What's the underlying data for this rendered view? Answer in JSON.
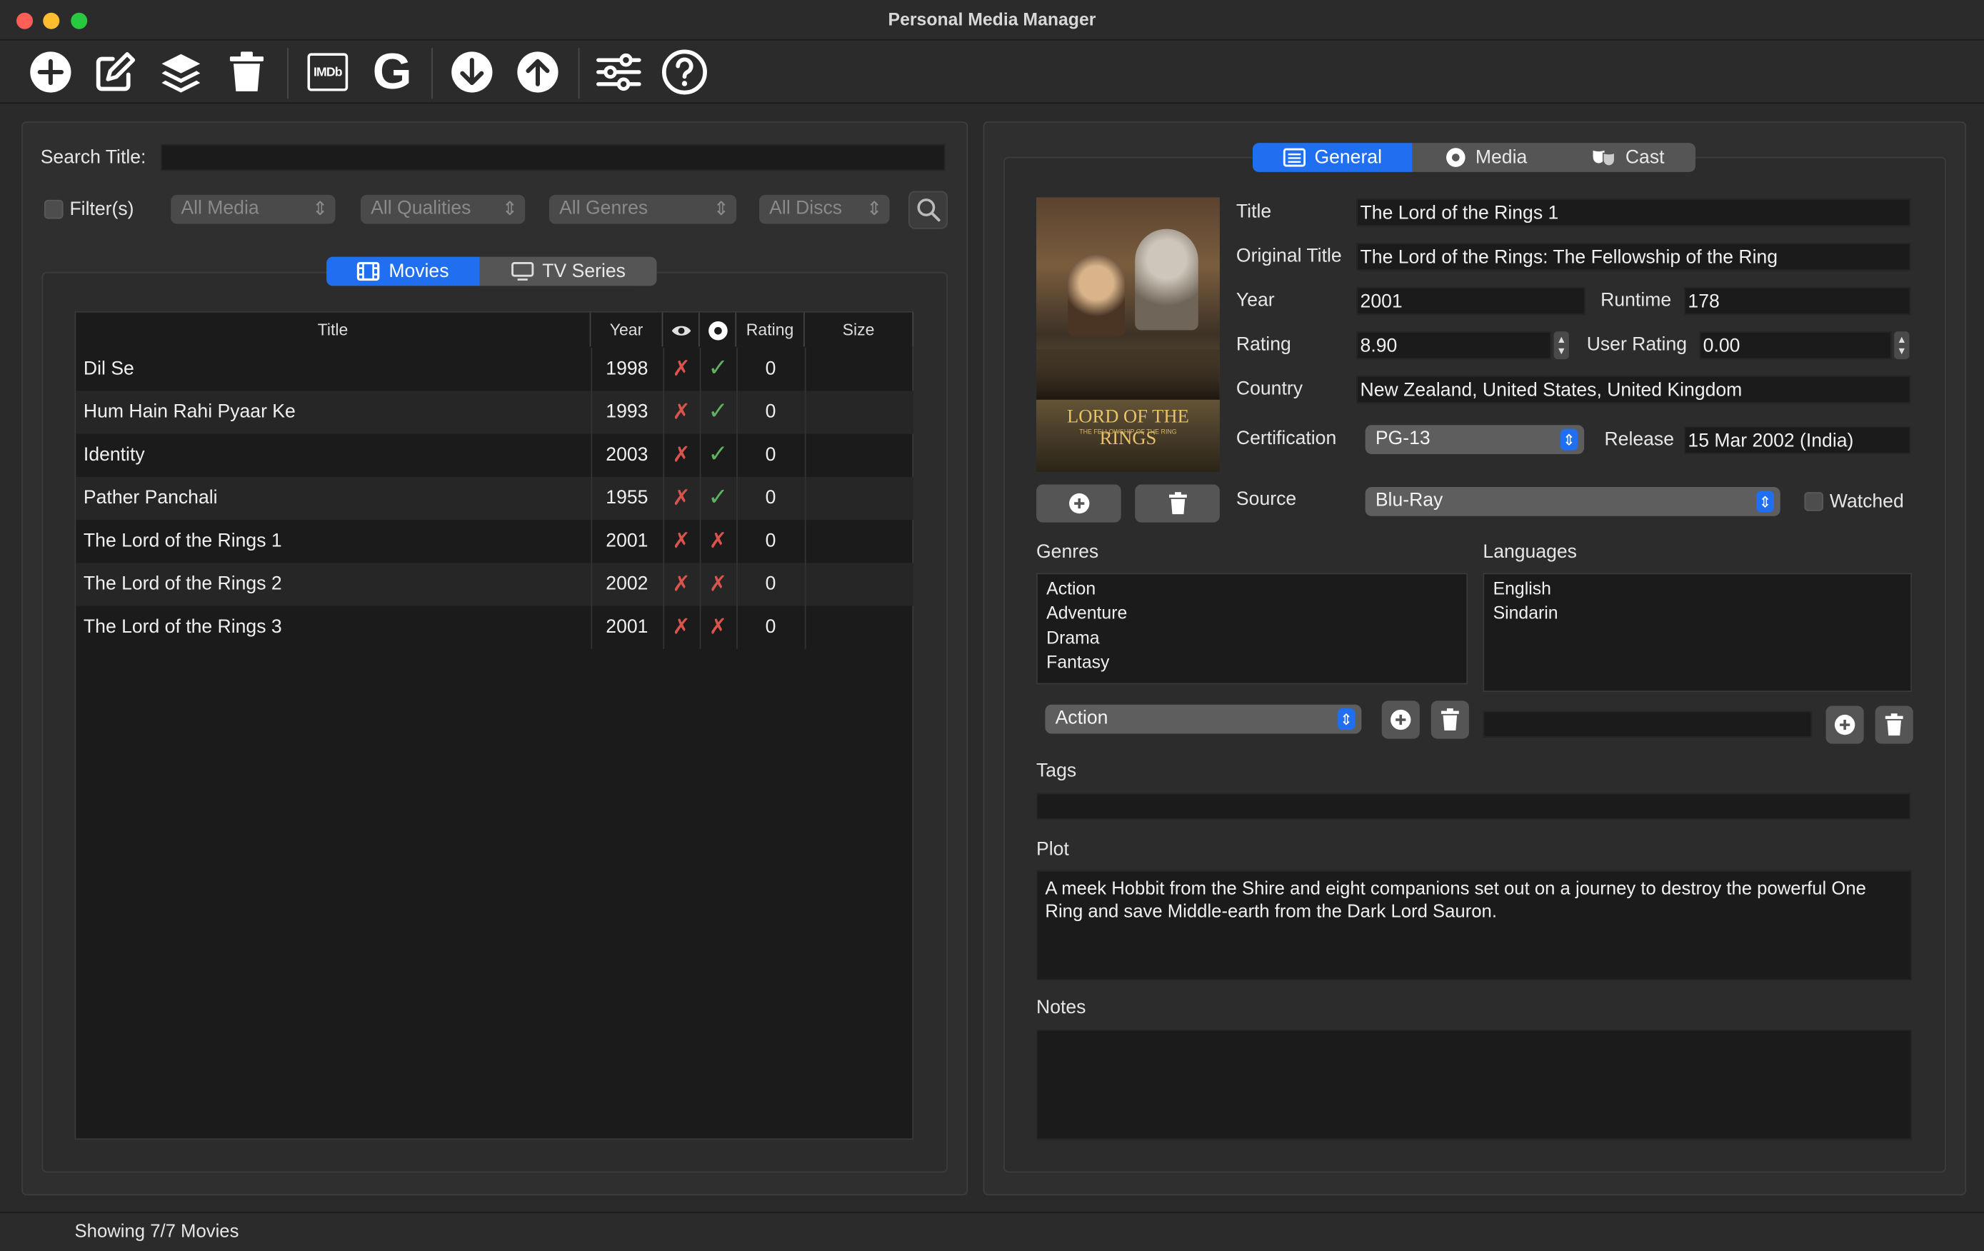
{
  "window": {
    "title": "Personal Media Manager"
  },
  "toolbar": {
    "imdb_label": "IMDb",
    "google_label": "G"
  },
  "left": {
    "search_label": "Search Title:",
    "search_value": "",
    "filter_label": "Filter(s)",
    "filters": [
      "All Media",
      "All Qualities",
      "All Genres",
      "All Discs"
    ],
    "tabs": [
      "Movies",
      "TV Series"
    ],
    "columns": [
      "Title",
      "Year",
      "Rating",
      "Size"
    ],
    "rows": [
      {
        "title": "Dil Se",
        "year": "1998",
        "watched": "✗",
        "disc": "✓",
        "rating": "0",
        "size": ""
      },
      {
        "title": "Hum Hain Rahi Pyaar Ke",
        "year": "1993",
        "watched": "✗",
        "disc": "✓",
        "rating": "0",
        "size": ""
      },
      {
        "title": "Identity",
        "year": "2003",
        "watched": "✗",
        "disc": "✓",
        "rating": "0",
        "size": ""
      },
      {
        "title": "Pather Panchali",
        "year": "1955",
        "watched": "✗",
        "disc": "✓",
        "rating": "0",
        "size": ""
      },
      {
        "title": "The Lord of the Rings 1",
        "year": "2001",
        "watched": "✗",
        "disc": "✗",
        "rating": "0",
        "size": ""
      },
      {
        "title": "The Lord of the Rings 2",
        "year": "2002",
        "watched": "✗",
        "disc": "✗",
        "rating": "0",
        "size": ""
      },
      {
        "title": "The Lord of the Rings 3",
        "year": "2001",
        "watched": "✗",
        "disc": "✗",
        "rating": "0",
        "size": ""
      }
    ]
  },
  "right": {
    "tabs": [
      "General",
      "Media",
      "Cast"
    ],
    "poster": {
      "title_text": "LORD OF THE RINGS",
      "subtitle_text": "THE FELLOWSHIP OF THE RING"
    },
    "labels": {
      "title": "Title",
      "original_title": "Original Title",
      "year": "Year",
      "runtime": "Runtime",
      "rating": "Rating",
      "user_rating": "User Rating",
      "country": "Country",
      "certification": "Certification",
      "release": "Release",
      "source": "Source",
      "watched": "Watched",
      "genres": "Genres",
      "languages": "Languages",
      "tags": "Tags",
      "plot": "Plot",
      "notes": "Notes"
    },
    "values": {
      "title": "The Lord of the Rings 1",
      "original_title": "The Lord of the Rings: The Fellowship of the Ring",
      "year": "2001",
      "runtime": "178",
      "rating": "8.90",
      "user_rating": "0.00",
      "country": "New Zealand, United States, United Kingdom",
      "certification": "PG-13",
      "release": "15 Mar 2002 (India)",
      "source": "Blu-Ray",
      "genre_select": "Action",
      "language_input": "",
      "tags": "",
      "plot": "A meek Hobbit from the Shire and eight companions set out on a journey to destroy the powerful One Ring and save Middle-earth from the Dark Lord Sauron.",
      "notes": ""
    },
    "genres": [
      "Action",
      "Adventure",
      "Drama",
      "Fantasy"
    ],
    "languages": [
      "English",
      "Sindarin"
    ]
  },
  "status": {
    "text": "Showing 7/7 Movies"
  },
  "colors": {
    "accent": "#1f6ff0",
    "cross": "#d9544d",
    "check": "#5fb35f"
  }
}
